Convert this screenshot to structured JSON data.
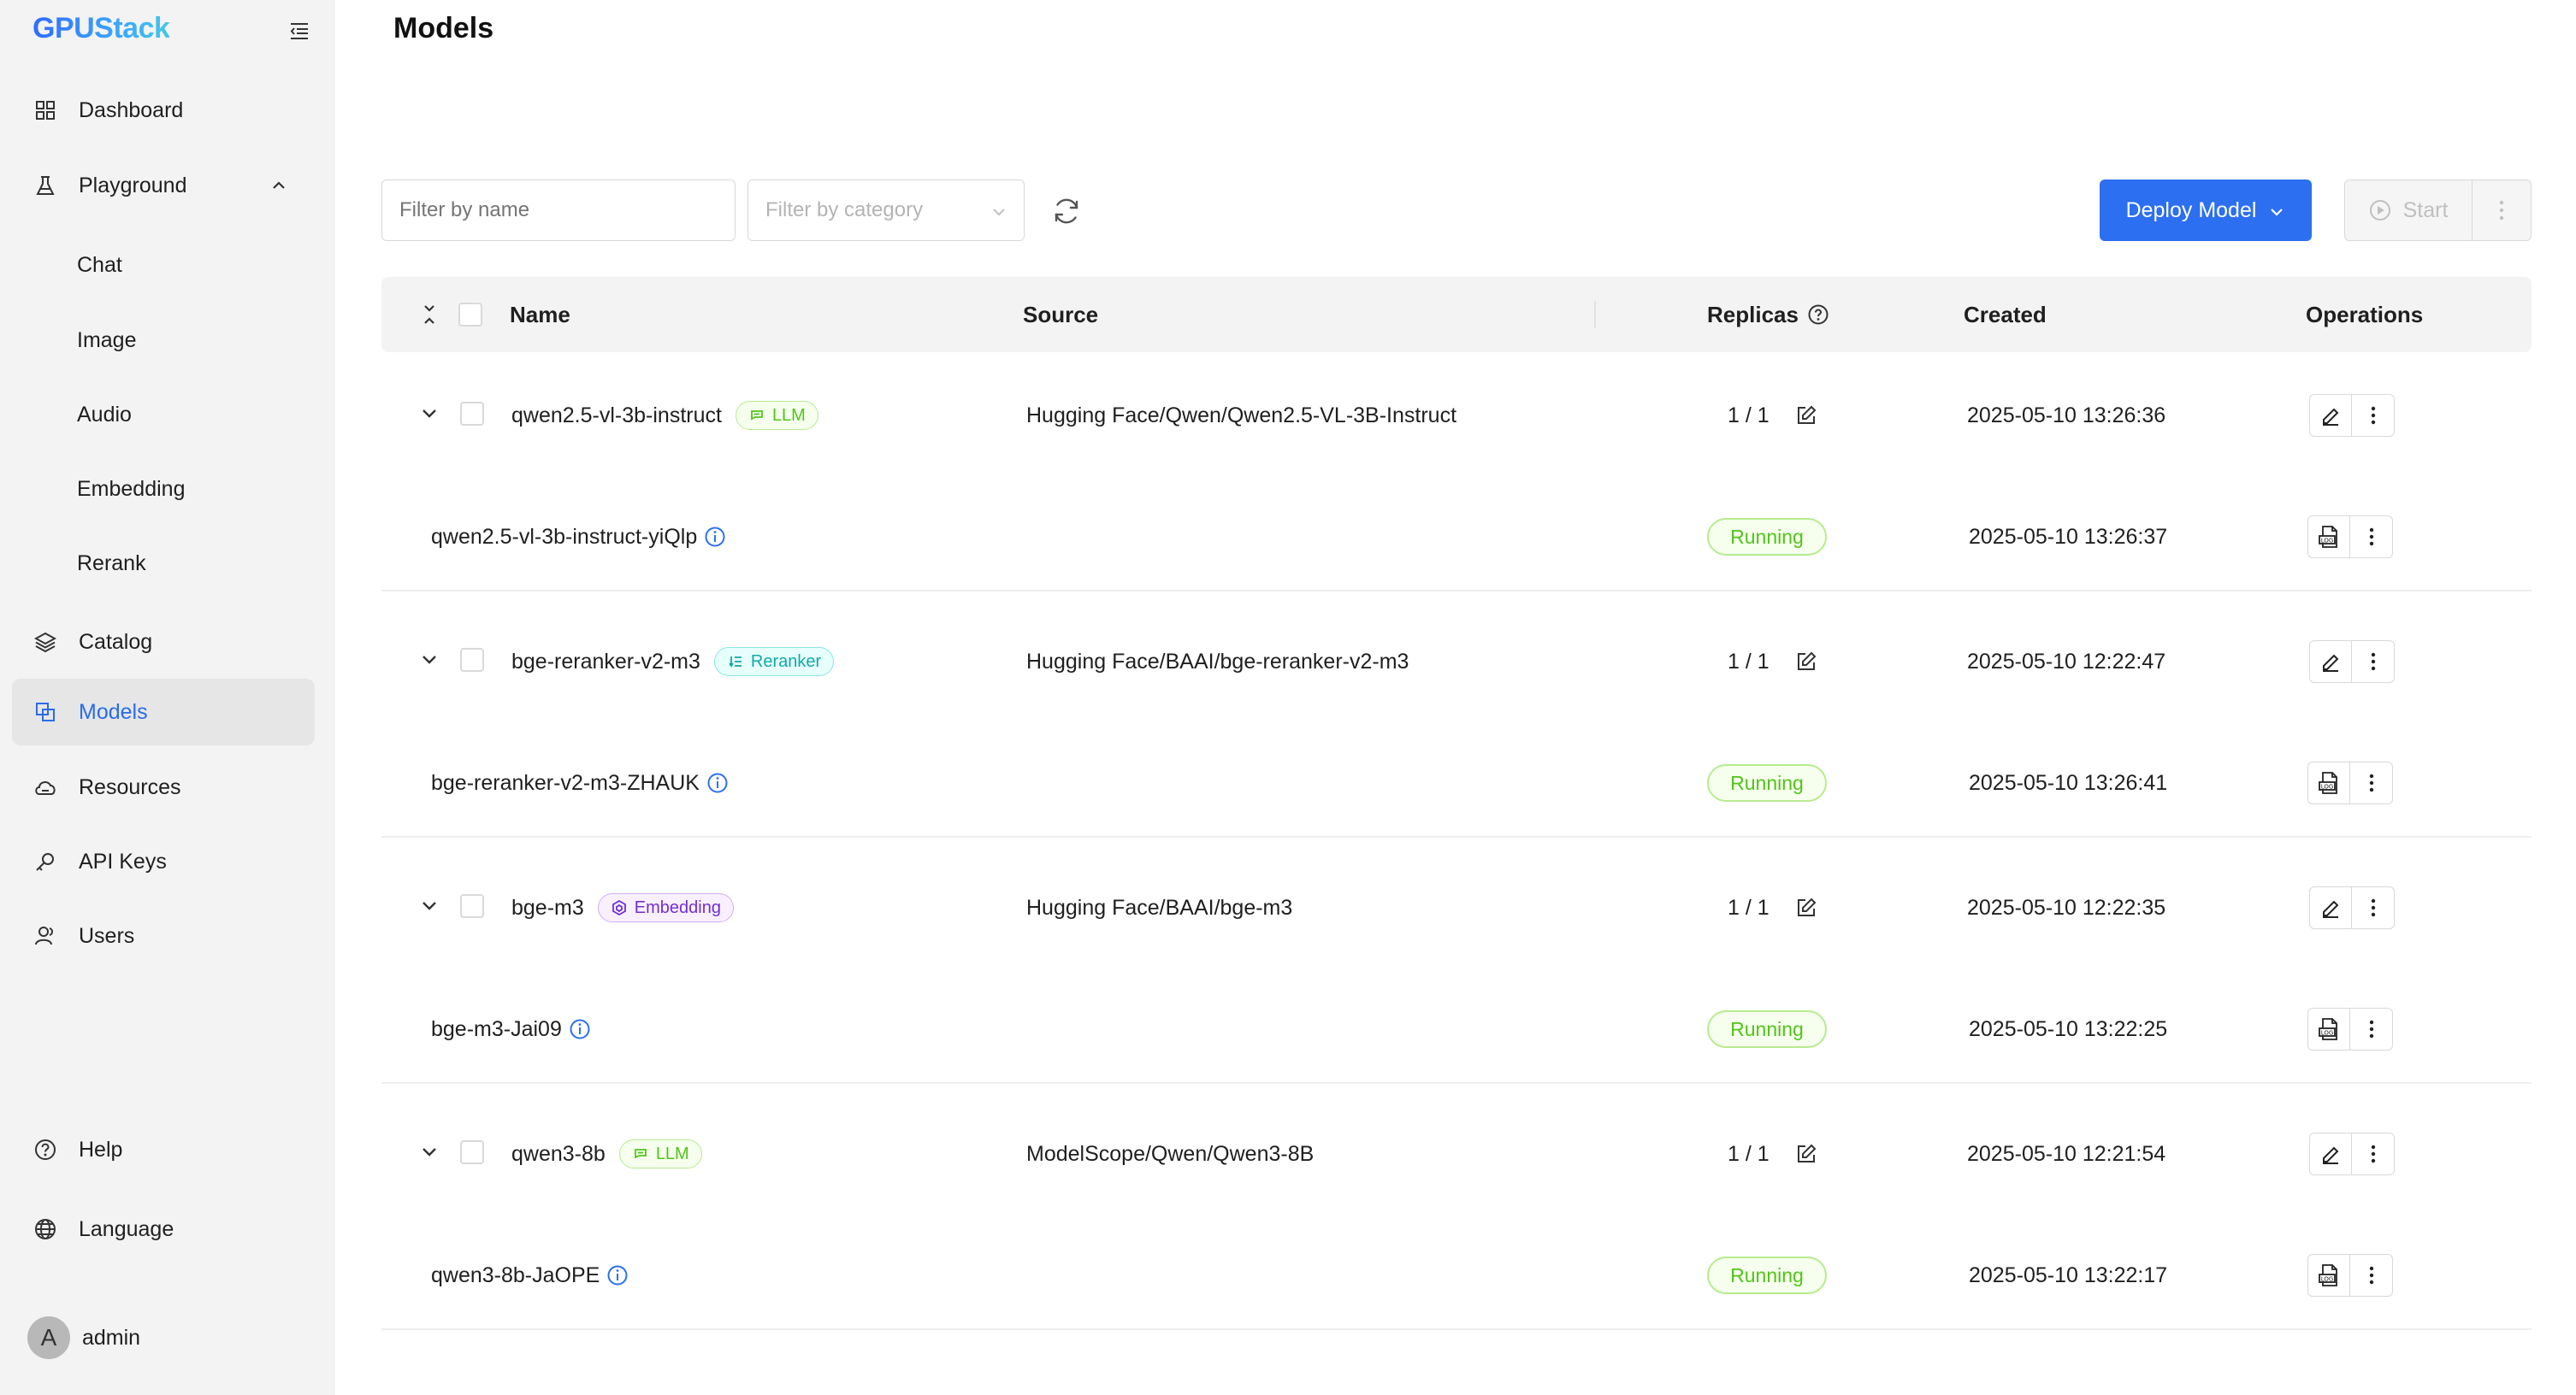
{
  "app": {
    "logo": "GPUStack"
  },
  "sidebar": {
    "items": [
      {
        "label": "Dashboard",
        "icon": "dashboard-icon"
      },
      {
        "label": "Playground",
        "icon": "flask-icon"
      },
      {
        "label": "Catalog",
        "icon": "layers-icon"
      },
      {
        "label": "Models",
        "icon": "models-icon"
      },
      {
        "label": "Resources",
        "icon": "cloud-icon"
      },
      {
        "label": "API Keys",
        "icon": "key-icon"
      },
      {
        "label": "Users",
        "icon": "users-icon"
      }
    ],
    "playground_sub": [
      "Chat",
      "Image",
      "Audio",
      "Embedding",
      "Rerank"
    ],
    "help": "Help",
    "language": "Language",
    "user": {
      "avatar_letter": "A",
      "name": "admin"
    }
  },
  "page": {
    "title": "Models"
  },
  "toolbar": {
    "filter_name_placeholder": "Filter by name",
    "filter_category_placeholder": "Filter by category",
    "deploy_label": "Deploy Model",
    "start_label": "Start"
  },
  "table": {
    "headers": {
      "name": "Name",
      "source": "Source",
      "replicas": "Replicas",
      "created": "Created",
      "operations": "Operations"
    },
    "models": [
      {
        "name": "qwen2.5-vl-3b-instruct",
        "tag": "LLM",
        "source": "Hugging Face/Qwen/Qwen2.5-VL-3B-Instruct",
        "replicas": "1 / 1",
        "created": "2025-05-10 13:26:36",
        "instance": {
          "name": "qwen2.5-vl-3b-instruct-yiQlp",
          "status": "Running",
          "created": "2025-05-10 13:26:37"
        }
      },
      {
        "name": "bge-reranker-v2-m3",
        "tag": "Reranker",
        "source": "Hugging Face/BAAI/bge-reranker-v2-m3",
        "replicas": "1 / 1",
        "created": "2025-05-10 12:22:47",
        "instance": {
          "name": "bge-reranker-v2-m3-ZHAUK",
          "status": "Running",
          "created": "2025-05-10 13:26:41"
        }
      },
      {
        "name": "bge-m3",
        "tag": "Embedding",
        "source": "Hugging Face/BAAI/bge-m3",
        "replicas": "1 / 1",
        "created": "2025-05-10 12:22:35",
        "instance": {
          "name": "bge-m3-Jai09",
          "status": "Running",
          "created": "2025-05-10 13:22:25"
        }
      },
      {
        "name": "qwen3-8b",
        "tag": "LLM",
        "source": "ModelScope/Qwen/Qwen3-8B",
        "replicas": "1 / 1",
        "created": "2025-05-10 12:21:54",
        "instance": {
          "name": "qwen3-8b-JaOPE",
          "status": "Running",
          "created": "2025-05-10 13:22:17"
        }
      }
    ]
  },
  "colors": {
    "primary": "#2c6ff0",
    "running": "#52c41a",
    "sidebar_bg": "#f3f3f3"
  }
}
